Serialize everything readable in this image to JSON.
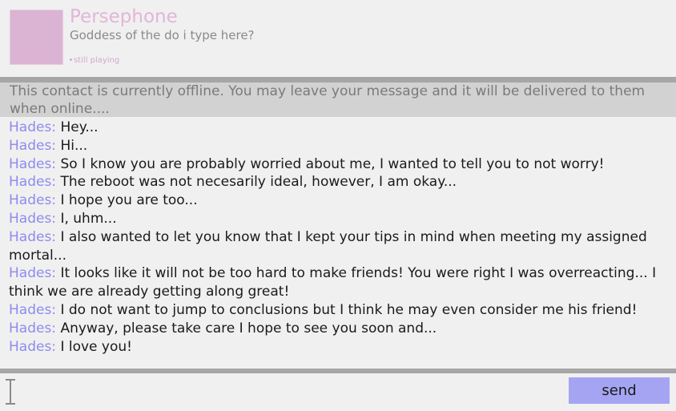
{
  "contact": {
    "name": "Persephone",
    "status_message": "Goddess of the do i type here?",
    "presence": "still playing"
  },
  "offline_notice": "This contact is currently offline. You may leave your message and it will be delivered to them when online....",
  "messages": [
    {
      "sender": "Hades:",
      "text": "Hey..."
    },
    {
      "sender": "Hades:",
      "text": "Hi..."
    },
    {
      "sender": "Hades:",
      "text": "So I know you are probably worried about me, I wanted to tell you to not worry!"
    },
    {
      "sender": "Hades:",
      "text": "The reboot was not necesarily ideal, however, I am okay..."
    },
    {
      "sender": "Hades:",
      "text": "I hope you are too..."
    },
    {
      "sender": "Hades:",
      "text": "I, uhm..."
    },
    {
      "sender": "Hades:",
      "text": "I also wanted to let you know that I kept your tips in mind when meeting my assigned mortal..."
    },
    {
      "sender": "Hades:",
      "text": "It looks like it will not be too hard to make friends! You were right I was overreacting... I think we are already getting along great!"
    },
    {
      "sender": "Hades:",
      "text": "I do not want to jump to conclusions but I think he may even consider me his friend!"
    },
    {
      "sender": "Hades:",
      "text": "Anyway, please take care I hope to see you soon and..."
    },
    {
      "sender": "Hades:",
      "text": "I love you!"
    }
  ],
  "composer": {
    "input_value": "",
    "send_label": "send"
  },
  "icons": {
    "avatar": "avatar-placeholder",
    "cursor": "text-cursor-icon"
  },
  "colors": {
    "name": "#e2b6d8",
    "avatar": "#dcb4d3",
    "sender": "#8d8bee",
    "send_button": "#a5a4f3",
    "divider": "#a6a6a6",
    "notice_bg": "#d2d2d2"
  }
}
